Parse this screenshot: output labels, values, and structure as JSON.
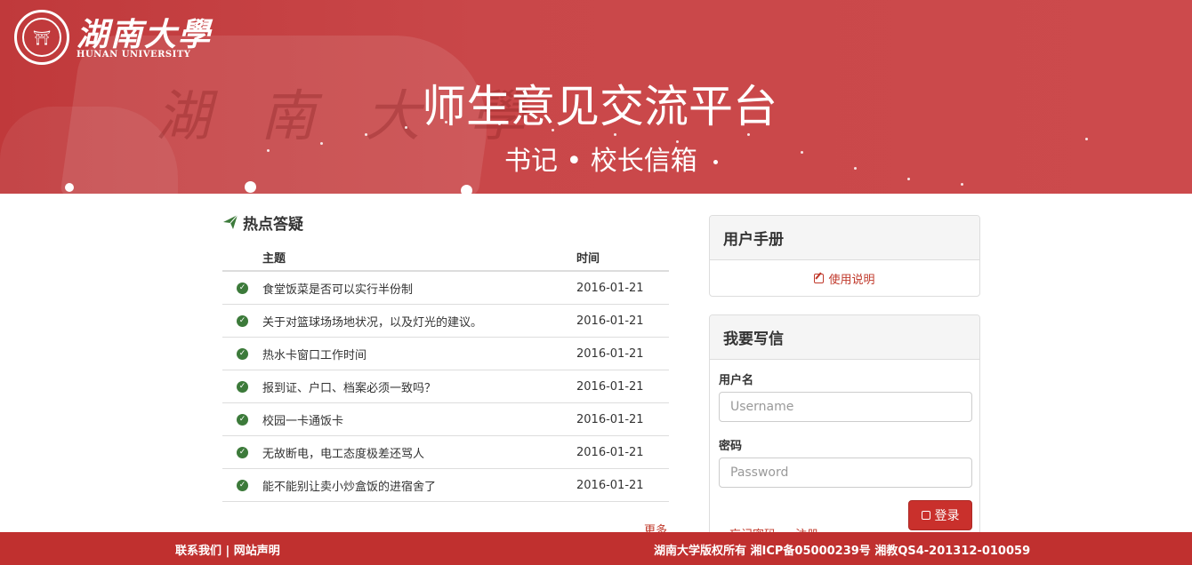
{
  "header": {
    "logo_cn": "湖南大學",
    "logo_en": "HUNAN UNIVERSITY",
    "title": "师生意见交流平台",
    "subtitle": "书记 • 校长信箱"
  },
  "hot": {
    "title": "热点答疑",
    "columns": [
      "主题",
      "时间"
    ],
    "rows": [
      {
        "topic": "食堂饭菜是否可以实行半份制",
        "date": "2016-01-21"
      },
      {
        "topic": "关于对篮球场场地状况，以及灯光的建议。",
        "date": "2016-01-21"
      },
      {
        "topic": "热水卡窗口工作时间",
        "date": "2016-01-21"
      },
      {
        "topic": "报到证、户口、档案必须一致吗？",
        "date": "2016-01-21"
      },
      {
        "topic": "校园一卡通饭卡",
        "date": "2016-01-21"
      },
      {
        "topic": "无故断电，电工态度极差还骂人",
        "date": "2016-01-21"
      },
      {
        "topic": "能不能别让卖小炒盒饭的进宿舍了",
        "date": "2016-01-21"
      }
    ],
    "more": "更多"
  },
  "manual": {
    "title": "用户手册",
    "link": "使用说明"
  },
  "write": {
    "title": "我要写信",
    "username_label": "用户名",
    "username_placeholder": "Username",
    "password_label": "密码",
    "password_placeholder": "Password",
    "login": "登录",
    "forgot": "忘记密码",
    "register": "注册"
  },
  "footer": {
    "left": "联系我们 | 网站声明",
    "right": "湖南大学版权所有 湘ICP备05000239号 湘教QS4-201312-010059"
  }
}
